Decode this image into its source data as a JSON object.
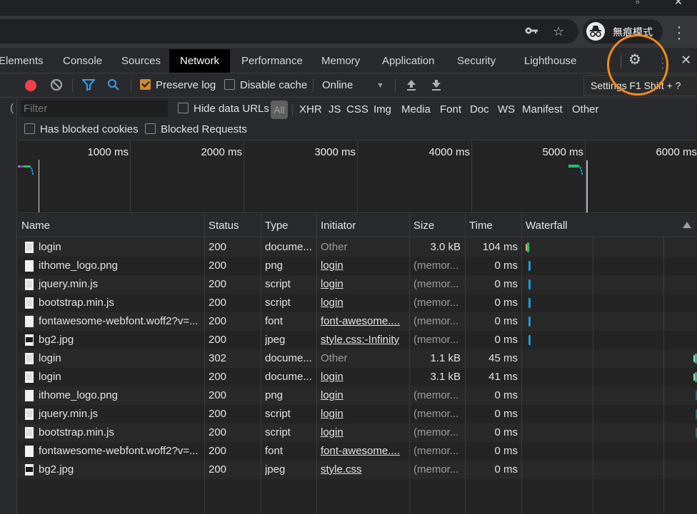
{
  "browser": {
    "incognito_label": "無痕模式",
    "icons": [
      "key-icon",
      "star-icon",
      "incognito-icon",
      "more-vert-icon"
    ]
  },
  "devtools": {
    "tabs": [
      {
        "label": "Elements"
      },
      {
        "label": "Console"
      },
      {
        "label": "Sources"
      },
      {
        "label": "Network",
        "active": true
      },
      {
        "label": "Performance"
      },
      {
        "label": "Memory"
      },
      {
        "label": "Application"
      },
      {
        "label": "Security"
      },
      {
        "label": "Lighthouse"
      }
    ],
    "settings_tooltip": "Settings  F1  Shift + ?"
  },
  "network_toolbar": {
    "preserve_log": {
      "label": "Preserve log",
      "checked": true
    },
    "disable_cache": {
      "label": "Disable cache",
      "checked": false
    },
    "throttling": "Online"
  },
  "filter": {
    "placeholder": "Filter",
    "hide_data_urls": {
      "label": "Hide data URLs",
      "checked": false
    },
    "types": [
      "All",
      "XHR",
      "JS",
      "CSS",
      "Img",
      "Media",
      "Font",
      "Doc",
      "WS",
      "Manifest",
      "Other"
    ],
    "active_type": "All",
    "has_blocked_cookies": {
      "label": "Has blocked cookies",
      "checked": false
    },
    "blocked_requests": {
      "label": "Blocked Requests",
      "checked": false
    }
  },
  "overview": {
    "ticks": [
      "1000 ms",
      "2000 ms",
      "3000 ms",
      "4000 ms",
      "5000 ms",
      "6000 ms"
    ]
  },
  "table": {
    "headers": {
      "name": "Name",
      "status": "Status",
      "type": "Type",
      "initiator": "Initiator",
      "size": "Size",
      "time": "Time",
      "waterfall": "Waterfall"
    },
    "rows": [
      {
        "name": "login",
        "icon": "doc",
        "status": "200",
        "type": "docume...",
        "initiator": "Other",
        "initiator_link": false,
        "size": "3.0 kB",
        "time": "104 ms",
        "wf": "doc-start"
      },
      {
        "name": "ithome_logo.png",
        "icon": "blank",
        "status": "200",
        "type": "png",
        "initiator": "login",
        "initiator_link": true,
        "size": "(memor...",
        "time": "0 ms",
        "wf": "blue-start"
      },
      {
        "name": "jquery.min.js",
        "icon": "doc",
        "status": "200",
        "type": "script",
        "initiator": "login",
        "initiator_link": true,
        "size": "(memor...",
        "time": "0 ms",
        "wf": "blue-start"
      },
      {
        "name": "bootstrap.min.js",
        "icon": "doc",
        "status": "200",
        "type": "script",
        "initiator": "login",
        "initiator_link": true,
        "size": "(memor...",
        "time": "0 ms",
        "wf": "blue-start"
      },
      {
        "name": "fontawesome-webfont.woff2?v=...",
        "icon": "blank",
        "status": "200",
        "type": "font",
        "initiator": "font-awesome....",
        "initiator_link": true,
        "size": "(memor...",
        "time": "0 ms",
        "wf": "blue-start"
      },
      {
        "name": "bg2.jpg",
        "icon": "img",
        "status": "200",
        "type": "jpeg",
        "initiator": "style.css:-Infinity",
        "initiator_link": true,
        "size": "(memor...",
        "time": "0 ms",
        "wf": "blue-start"
      },
      {
        "name": "login",
        "icon": "doc",
        "status": "302",
        "type": "docume...",
        "initiator": "Other",
        "initiator_link": false,
        "size": "1.1 kB",
        "time": "45 ms",
        "wf": "doc-end"
      },
      {
        "name": "login",
        "icon": "doc",
        "status": "200",
        "type": "docume...",
        "initiator": "login",
        "initiator_link": true,
        "size": "3.1 kB",
        "time": "41 ms",
        "wf": "doc-end"
      },
      {
        "name": "ithome_logo.png",
        "icon": "blank",
        "status": "200",
        "type": "png",
        "initiator": "login",
        "initiator_link": true,
        "size": "(memor...",
        "time": "0 ms",
        "wf": "blue-end"
      },
      {
        "name": "jquery.min.js",
        "icon": "doc",
        "status": "200",
        "type": "script",
        "initiator": "login",
        "initiator_link": true,
        "size": "(memor...",
        "time": "0 ms",
        "wf": "blue-end"
      },
      {
        "name": "bootstrap.min.js",
        "icon": "doc",
        "status": "200",
        "type": "script",
        "initiator": "login",
        "initiator_link": true,
        "size": "(memor...",
        "time": "0 ms",
        "wf": "blue-end"
      },
      {
        "name": "fontawesome-webfont.woff2?v=...",
        "icon": "blank",
        "status": "200",
        "type": "font",
        "initiator": "font-awesome....",
        "initiator_link": true,
        "size": "(memor...",
        "time": "0 ms",
        "wf": "none"
      },
      {
        "name": "bg2.jpg",
        "icon": "img",
        "status": "200",
        "type": "jpeg",
        "initiator": "style.css",
        "initiator_link": true,
        "size": "(memor...",
        "time": "0 ms",
        "wf": "none"
      }
    ]
  },
  "colors": {
    "record": "#f2404a",
    "checkbox_checked": "#d0892f",
    "filter_icon": "#3c9ce8",
    "wf_blue": "#1a9be0",
    "wf_green": "#1fc16b",
    "annotation": "#f28a1e"
  }
}
